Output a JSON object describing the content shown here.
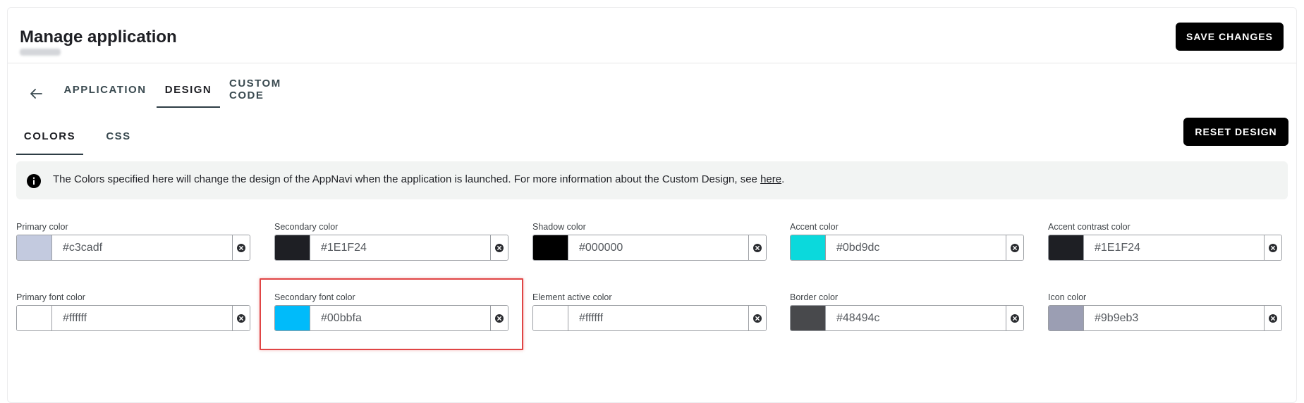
{
  "header": {
    "title": "Manage application",
    "save_label": "SAVE CHANGES"
  },
  "main_tabs": [
    {
      "label": "APPLICATION",
      "active": false
    },
    {
      "label": "DESIGN",
      "active": true
    },
    {
      "label": "CUSTOM CODE",
      "active": false
    }
  ],
  "sub_tabs": [
    {
      "label": "COLORS",
      "active": true
    },
    {
      "label": "CSS",
      "active": false
    }
  ],
  "reset_label": "RESET DESIGN",
  "info": {
    "text": "The Colors specified here will change the design of the AppNavi when the application is launched. For more information about the Custom Design, see ",
    "link": "here",
    "suffix": "."
  },
  "colors": [
    {
      "label": "Primary color",
      "value": "#c3cadf",
      "swatch": "#c3cadf"
    },
    {
      "label": "Secondary color",
      "value": "#1E1F24",
      "swatch": "#1E1F24"
    },
    {
      "label": "Shadow color",
      "value": "#000000",
      "swatch": "#000000"
    },
    {
      "label": "Accent color",
      "value": "#0bd9dc",
      "swatch": "#0bd9dc"
    },
    {
      "label": "Accent contrast color",
      "value": "#1E1F24",
      "swatch": "#1E1F24"
    },
    {
      "label": "Primary font color",
      "value": "#ffffff",
      "swatch": "#ffffff"
    },
    {
      "label": "Secondary font color",
      "value": "#00bbfa",
      "swatch": "#00bbfa"
    },
    {
      "label": "Element active color",
      "value": "#ffffff",
      "swatch": "#ffffff"
    },
    {
      "label": "Border color",
      "value": "#48494c",
      "swatch": "#48494c"
    },
    {
      "label": "Icon color",
      "value": "#9b9eb3",
      "swatch": "#9b9eb3"
    }
  ]
}
